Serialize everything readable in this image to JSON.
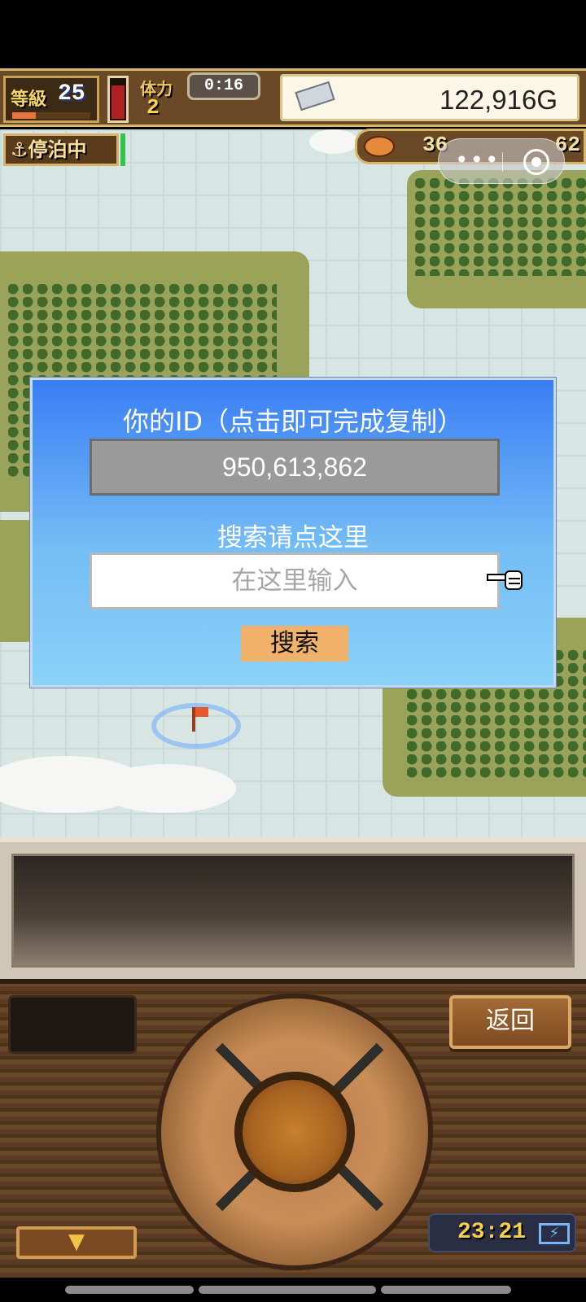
{
  "hud": {
    "level_label": "等級",
    "level": "25",
    "level_progress": 0.3,
    "stamina_label": "体力",
    "stamina": "2",
    "stamina_fill": 0.85,
    "timer": "0:16",
    "gold": "122,916G"
  },
  "status": {
    "docked_label": "停泊中",
    "resource_food": "36",
    "resource_other": "62"
  },
  "mini_program": {
    "more_icon": "more-dots-icon",
    "close_icon": "target-close-icon"
  },
  "dialog": {
    "title": "你的ID（点击即可完成复制）",
    "user_id": "950,613,862",
    "search_hint": "搜索请点这里",
    "search_placeholder": "在这里输入",
    "search_button": "搜索"
  },
  "controls": {
    "back_button": "返回",
    "menu_toggle_icon": "triangle-down-icon",
    "clock": "23:21",
    "battery_icon": "battery-charging-icon"
  },
  "colors": {
    "dialog_top": "#3a7ef4",
    "dialog_bottom": "#8ad2f7",
    "search_button": "#f0b26a"
  }
}
